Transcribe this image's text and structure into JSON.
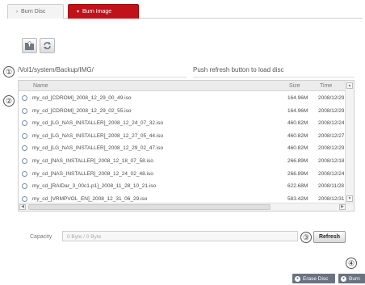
{
  "tabs": [
    {
      "label": "Burn Disc",
      "active": false
    },
    {
      "label": "Burn Image",
      "active": true
    }
  ],
  "toolbar": {
    "upload_icon": "folder-up-icon",
    "refresh_icon": "refresh-icon"
  },
  "callouts": [
    "①",
    "②",
    "③",
    "④"
  ],
  "path": "/Vol1/system/Backup/IMG/",
  "status_message": "Push refresh button to load disc",
  "file_list": {
    "columns": {
      "name": "Name",
      "size": "Size",
      "time": "Time"
    },
    "rows": [
      {
        "name": "my_cd_[CDROM]_2008_12_29_00_49.iso",
        "size": "164.96M",
        "time": "2008/12/29"
      },
      {
        "name": "my_cd_[CDROM]_2008_12_29_02_55.iso",
        "size": "164.96M",
        "time": "2008/12/29"
      },
      {
        "name": "my_cd_[LG_NAS_INSTALLER]_2008_12_24_07_32.iso",
        "size": "460.82M",
        "time": "2008/12/24"
      },
      {
        "name": "my_cd_[LG_NAS_INSTALLER]_2008_12_27_05_44.iso",
        "size": "460.82M",
        "time": "2008/12/27"
      },
      {
        "name": "my_cd_[LG_NAS_INSTALLER]_2008_12_29_02_47.iso",
        "size": "460.82M",
        "time": "2008/12/29"
      },
      {
        "name": "my_cd_[NAS_INSTALLER]_2008_12_18_07_58.iso",
        "size": "266.89M",
        "time": "2008/12/18"
      },
      {
        "name": "my_cd_[NAS_INSTALLER]_2008_12_24_02_48.iso",
        "size": "266.89M",
        "time": "2008/12/24"
      },
      {
        "name": "my_cd_[RAIDar_3_00c1-p1]_2008_11_28_10_21.iso",
        "size": "622.68M",
        "time": "2008/11/28"
      },
      {
        "name": "my_cd_[VRMPVOL_EN]_2008_12_31_06_29.iso",
        "size": "583.42M",
        "time": "2008/12/31"
      }
    ]
  },
  "capacity": {
    "label": "Capacity",
    "value": "0 Byte / 0 Byte"
  },
  "buttons": {
    "refresh": "Refresh",
    "erase_disc": "Erase Disc",
    "burn": "Burn"
  },
  "colors": {
    "active_tab": "#c0121b",
    "bottom_button": "#6b7280"
  }
}
